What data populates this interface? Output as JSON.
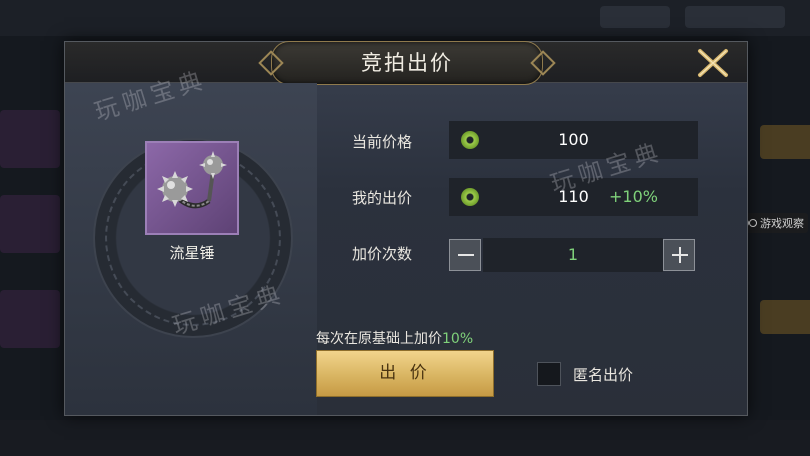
{
  "dialog": {
    "title": "竞拍出价",
    "close_icon": "close-x-icon"
  },
  "item": {
    "name": "流星锤",
    "icon": "meteor-hammer-icon",
    "rarity_color": "#7a58a0"
  },
  "current_price": {
    "label": "当前价格",
    "value": "100",
    "currency_icon": "jade-coin-icon"
  },
  "my_bid": {
    "label": "我的出价",
    "value": "110",
    "bonus": "+10%",
    "currency_icon": "jade-coin-icon"
  },
  "raise_count": {
    "label": "加价次数",
    "value": "1",
    "minus_icon": "minus-icon",
    "plus_icon": "plus-icon"
  },
  "hint": {
    "text": "每次在原基础上加价",
    "percent": "10%"
  },
  "bid_button": {
    "label": "出 价"
  },
  "anonymous": {
    "label": "匿名出价",
    "checked": false
  },
  "watermarks": [
    "玩咖宝典",
    "玩咖宝典",
    "玩咖宝典"
  ],
  "side_watermark": "游戏观察",
  "colors": {
    "accent_green": "#7fd17a",
    "button_gold": "#e2be6b"
  }
}
